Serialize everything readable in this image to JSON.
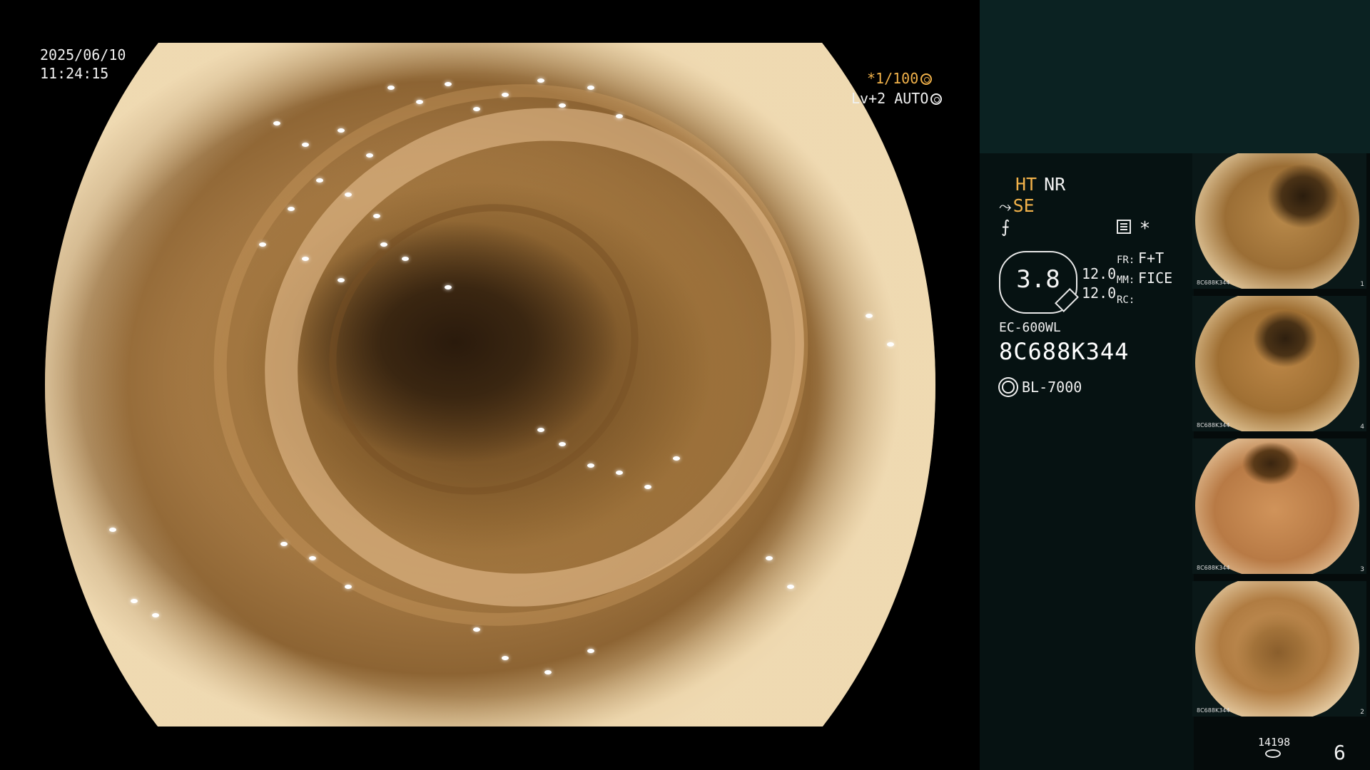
{
  "overlay": {
    "date": "2025/06/10",
    "time": "11:24:15",
    "shutter": "*1/100",
    "level": "Lv+2 AUTO"
  },
  "panel": {
    "ht": "HT",
    "nr": "NR",
    "se": "SE",
    "zoom": "3.8",
    "value_1": "12.0",
    "value_2": "12.0",
    "fr_label": "FR:",
    "fr_value": "F+T",
    "mm_label": "MM:",
    "mm_value": "FICE",
    "rc_label": "RC:",
    "rc_value": "",
    "scope_model": "EC-600WL",
    "scope_serial": "8C688K344",
    "light_source": "BL-7000",
    "image_count": "14198",
    "page": "6"
  },
  "thumbnails": [
    {
      "serial": "8C688K344",
      "index": "1"
    },
    {
      "serial": "8C688K344",
      "index": "4"
    },
    {
      "serial": "8C688K344",
      "index": "3"
    },
    {
      "serial": "8C688K344",
      "index": "2"
    }
  ],
  "icons": {
    "shutter_icon": "aperture-icon",
    "auto_icon": "iris-icon",
    "se_icon": "scope-icon",
    "f_icon": "freeze-icon",
    "mode_icon": "menu-icon",
    "light_icon": "light-source-icon",
    "storage_icon": "storage-icon"
  },
  "colors": {
    "accent": "#f2b24a",
    "panel_top": "#0b2222",
    "panel_body": "#061212"
  }
}
